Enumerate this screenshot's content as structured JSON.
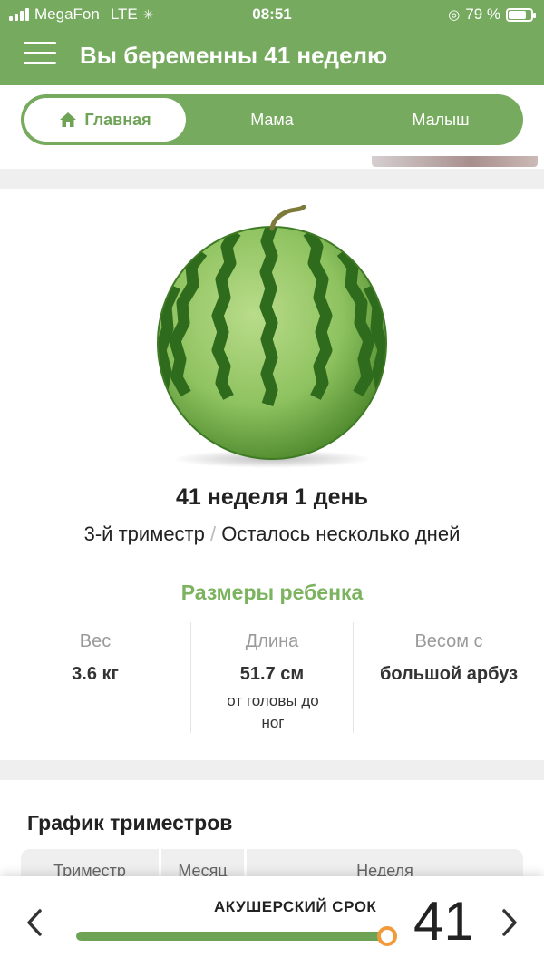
{
  "status_bar": {
    "carrier": "MegaFon",
    "network": "LTE",
    "time": "08:51",
    "battery_percent": "79 %",
    "battery_level": 0.79
  },
  "header": {
    "title": "Вы беременны 41 неделю"
  },
  "tabs": [
    {
      "label": "Главная",
      "active": true
    },
    {
      "label": "Мама",
      "active": false
    },
    {
      "label": "Малыш",
      "active": false
    }
  ],
  "week_card": {
    "title": "41 неделя 1 день",
    "trimester": "3-й триместр",
    "separator": "/",
    "remaining": "Осталось несколько дней",
    "sizes_title": "Размеры ребенка",
    "stats": [
      {
        "label": "Вес",
        "value": "3.6 кг",
        "note": ""
      },
      {
        "label": "Длина",
        "value": "51.7 см",
        "note": "от головы до ног"
      },
      {
        "label": "Весом с",
        "value": "большой арбуз",
        "note": ""
      }
    ]
  },
  "trimester_chart": {
    "title": "График триместров",
    "columns": [
      "Триместр",
      "Месяц",
      "Неделя"
    ]
  },
  "bottom_bar": {
    "label": "АКУШЕРСКИЙ СРОК",
    "week": "41",
    "progress": 1.0
  },
  "colors": {
    "brand_green": "#76aa5e",
    "accent_orange": "#f29a3a"
  }
}
